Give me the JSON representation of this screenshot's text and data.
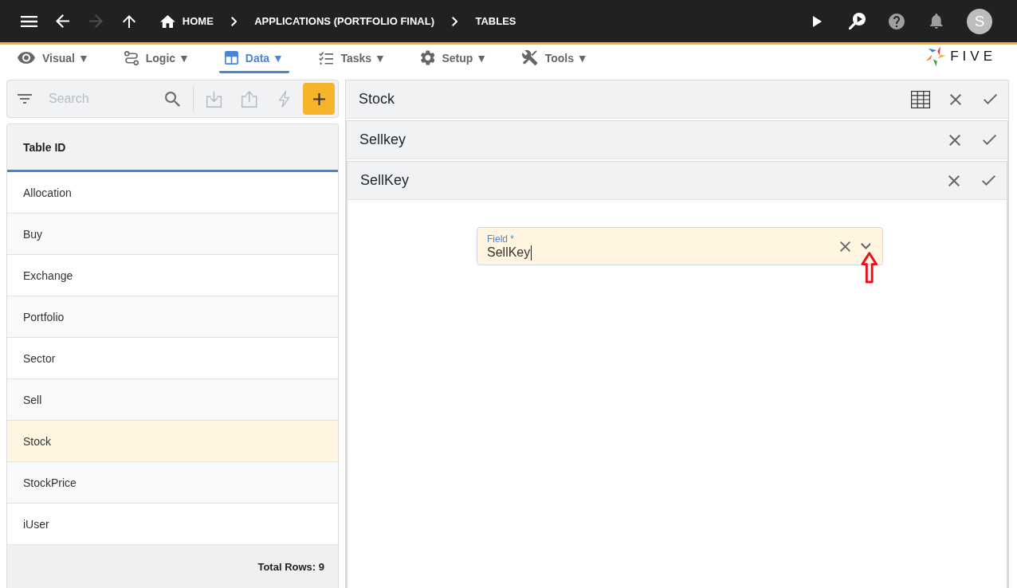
{
  "top_bar": {
    "nav_buttons": [
      {
        "kind": "menu",
        "disabled": false
      },
      {
        "kind": "back",
        "disabled": false
      },
      {
        "kind": "forward",
        "disabled": true
      },
      {
        "kind": "up",
        "disabled": false
      }
    ],
    "breadcrumbs": [
      {
        "kind": "home",
        "label": "HOME"
      },
      {
        "kind": "page",
        "label": "APPLICATIONS (PORTFOLIO FINAL)"
      },
      {
        "kind": "page",
        "label": "TABLES"
      }
    ],
    "actions": [
      {
        "kind": "play"
      },
      {
        "kind": "search-play"
      },
      {
        "kind": "help"
      },
      {
        "kind": "notifications"
      }
    ],
    "avatar": {
      "initial": "S"
    }
  },
  "menu": {
    "tabs": [
      {
        "kind": "visual",
        "label": "Visual ▼",
        "selected": false
      },
      {
        "kind": "logic",
        "label": "Logic ▼",
        "selected": false
      },
      {
        "kind": "data",
        "label": "Data ▼",
        "selected": true
      },
      {
        "kind": "tasks",
        "label": "Tasks ▼",
        "selected": false
      },
      {
        "kind": "setup",
        "label": "Setup ▼",
        "selected": false
      },
      {
        "kind": "tools",
        "label": "Tools ▼",
        "selected": false
      }
    ],
    "logo": {
      "text": "FIVE"
    }
  },
  "list_panel": {
    "search": {
      "placeholder": "Search"
    },
    "tools": [
      {
        "kind": "import",
        "disabled": true
      },
      {
        "kind": "export",
        "disabled": true
      },
      {
        "kind": "action",
        "disabled": true
      },
      {
        "kind": "add",
        "disabled": false
      }
    ],
    "table": {
      "columns": [
        "Table ID"
      ],
      "rows": [
        {
          "label": "Allocation",
          "selected": false
        },
        {
          "label": "Buy",
          "selected": false
        },
        {
          "label": "Exchange",
          "selected": false
        },
        {
          "label": "Portfolio",
          "selected": false
        },
        {
          "label": "Sector",
          "selected": false
        },
        {
          "label": "Sell",
          "selected": false
        },
        {
          "label": "Stock",
          "selected": true
        },
        {
          "label": "StockPrice",
          "selected": false
        },
        {
          "label": "iUser",
          "selected": false
        }
      ]
    },
    "footer": "Total Rows: 9"
  },
  "forms": [
    {
      "title": "Stock",
      "actions": [
        {
          "kind": "grid"
        },
        {
          "kind": "cancel"
        },
        {
          "kind": "save"
        }
      ]
    },
    {
      "title": "Sellkey",
      "actions": [
        {
          "kind": "cancel"
        },
        {
          "kind": "save"
        }
      ]
    },
    {
      "title": "SellKey",
      "actions": [
        {
          "kind": "cancel"
        },
        {
          "kind": "save"
        }
      ],
      "fields": [
        {
          "kind": "lookup",
          "label": "Field *",
          "value": "SellKey",
          "focused": true,
          "annotation": {
            "kind": "arrow-up"
          }
        }
      ]
    }
  ]
}
